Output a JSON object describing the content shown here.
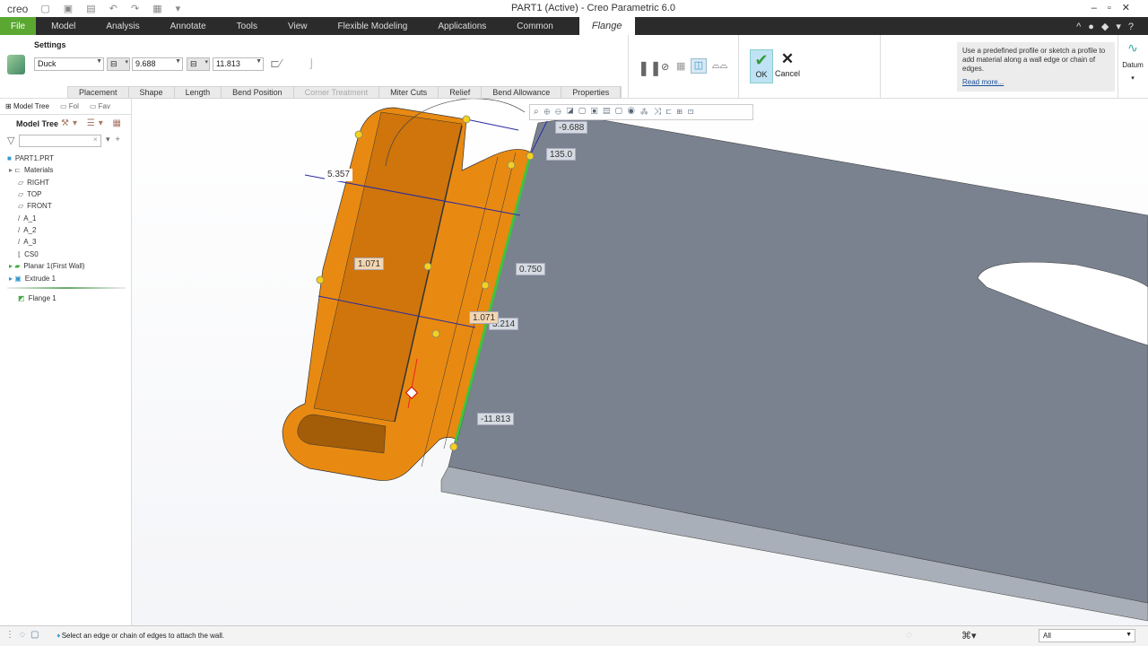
{
  "app": {
    "logo": "creo",
    "title": "PART1 (Active) - Creo Parametric 6.0"
  },
  "tabs": [
    {
      "label": "File"
    },
    {
      "label": "Model"
    },
    {
      "label": "Analysis"
    },
    {
      "label": "Annotate"
    },
    {
      "label": "Tools"
    },
    {
      "label": "View"
    },
    {
      "label": "Flexible Modeling"
    },
    {
      "label": "Applications"
    },
    {
      "label": "Common"
    },
    {
      "label": "Flange"
    }
  ],
  "ribbon": {
    "settings_label": "Settings",
    "shape": "Duck",
    "length1": "9.688",
    "length2": "11.813",
    "ok": "OK",
    "cancel": "Cancel",
    "datum": "Datum",
    "subtabs": [
      "Placement",
      "Shape",
      "Length",
      "Bend Position",
      "Corner Treatment",
      "Miter Cuts",
      "Relief",
      "Bend Allowance",
      "Properties"
    ],
    "help_text": "Use a predefined profile or sketch a profile to add material along a wall edge or chain of edges.",
    "read_more": "Read more..."
  },
  "sidebar": {
    "tabs": [
      "Model Tree",
      "Fol",
      "Fav"
    ],
    "header": "Model Tree",
    "filter_placeholder": "",
    "items": [
      {
        "label": "PART1.PRT"
      },
      {
        "label": "Materials"
      },
      {
        "label": "RIGHT"
      },
      {
        "label": "TOP"
      },
      {
        "label": "FRONT"
      },
      {
        "label": "A_1"
      },
      {
        "label": "A_2"
      },
      {
        "label": "A_3"
      },
      {
        "label": "CS0"
      },
      {
        "label": "Planar 1(First Wall)"
      },
      {
        "label": "Extrude 1"
      },
      {
        "label": "Flange 1"
      }
    ]
  },
  "dimensions": {
    "d1": "-9.688",
    "d2": "135.0",
    "d3": "5.357",
    "d4": "1.071",
    "d5": "0.750",
    "d6": "1.071",
    "d7": "3.214",
    "d8": "-11.813"
  },
  "status": {
    "message": "Select an edge or chain of edges to attach the wall.",
    "filter": "All"
  },
  "colors": {
    "flange": "#e88a12",
    "plate": "#7a8290",
    "selected_edge": "#3ec43e",
    "file_tab": "#5aa832"
  }
}
